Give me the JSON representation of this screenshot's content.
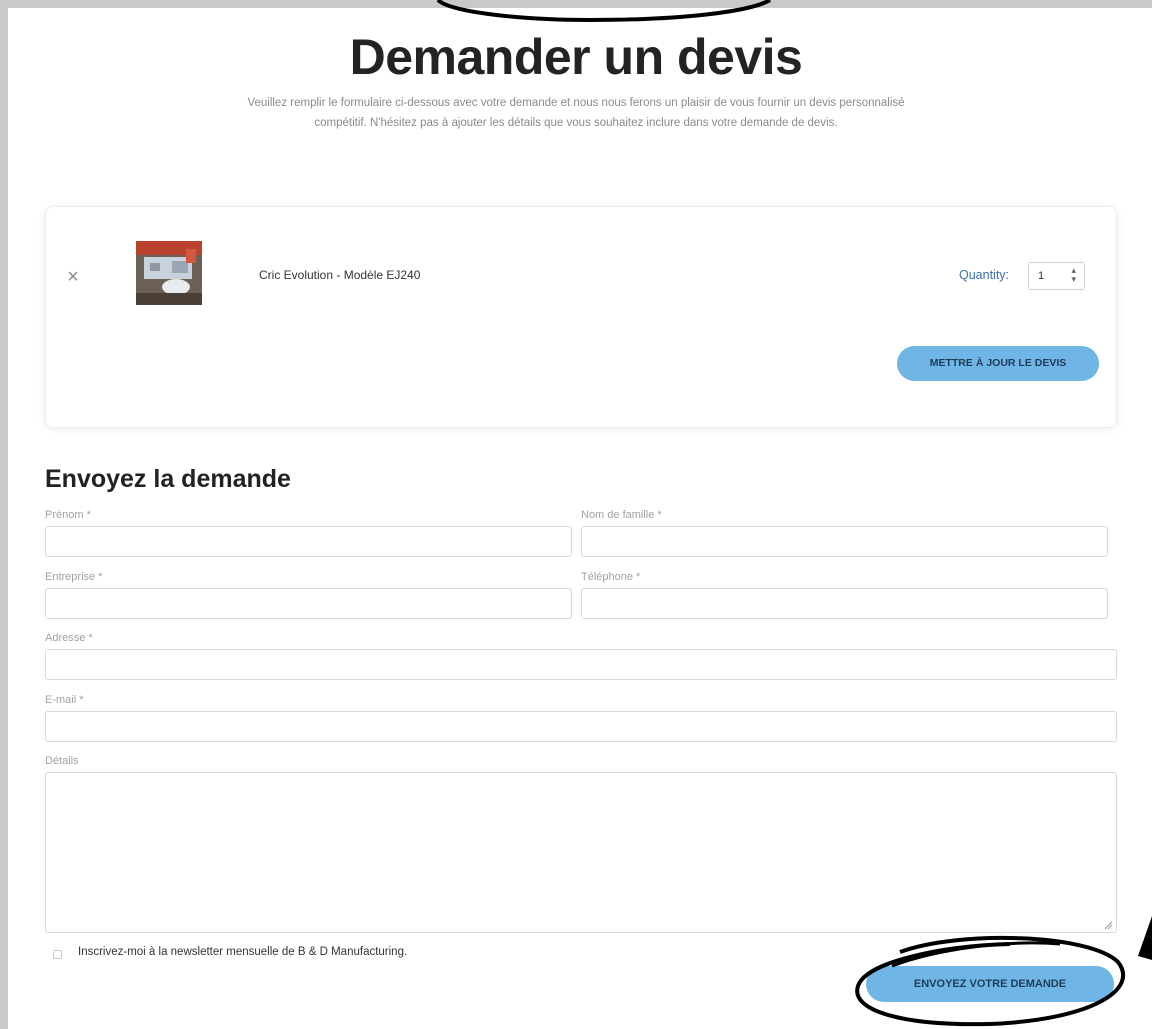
{
  "page": {
    "title": "Demander un devis",
    "intro": "Veuillez remplir le formulaire ci-dessous avec votre demande et nous nous ferons un plaisir de vous fournir un devis personnalisé compétitif. N'hésitez pas à ajouter les détails que vous souhaitez inclure dans votre demande de devis."
  },
  "quote": {
    "remove_icon": "×",
    "product_name": "Cric Evolution - Modèle EJ240",
    "quantity_label": "Quantity:",
    "quantity_value": "1",
    "update_button": "METTRE À JOUR LE DEVIS"
  },
  "form": {
    "title": "Envoyez la demande",
    "first_name_label": "Prénom *",
    "last_name_label": "Nom de famille *",
    "company_label": "Entreprise *",
    "phone_label": "Téléphone *",
    "address_label": "Adresse *",
    "email_label": "E-mail *",
    "details_label": "Détails",
    "newsletter_label": "Inscrivez-moi à la newsletter mensuelle de B & D Manufacturing.",
    "submit_button": "ENVOYEZ VOTRE DEMANDE"
  },
  "colors": {
    "accent": "#6fb6e6",
    "button_text": "#1f3b57",
    "quantity_label": "#3a6fb0"
  }
}
